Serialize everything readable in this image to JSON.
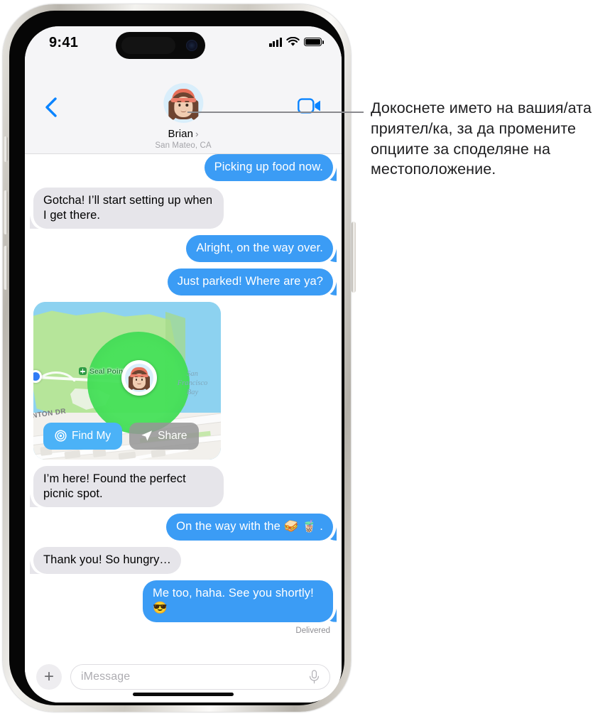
{
  "status_bar": {
    "time": "9:41",
    "cellular_icon": "cellular-signal-icon",
    "wifi_icon": "wifi-icon",
    "battery_icon": "battery-icon"
  },
  "nav": {
    "back_icon": "back-chevron-icon",
    "facetime_icon": "facetime-video-icon",
    "contact_name": "Brian",
    "name_chevron": "›",
    "location": "San Mateo, CA",
    "avatar_name": "memoji-avatar"
  },
  "messages": [
    {
      "id": "m1",
      "side": "out",
      "text": "Picking up food now."
    },
    {
      "id": "m2",
      "side": "in",
      "text": "Gotcha! I’ll start setting up when I get there."
    },
    {
      "id": "m3",
      "side": "out",
      "text": "Alright, on the way over."
    },
    {
      "id": "m4",
      "side": "out",
      "text": "Just parked! Where are ya?"
    },
    {
      "id": "m5",
      "side": "in",
      "text": "I’m here! Found the perfect picnic spot."
    },
    {
      "id": "m6",
      "side": "out",
      "text": "On the way with the 🥪 🧋 ."
    },
    {
      "id": "m7",
      "side": "in",
      "text": "Thank you! So hungry…"
    },
    {
      "id": "m8",
      "side": "out",
      "text": "Me too, haha. See you shortly! 😎"
    }
  ],
  "delivery_status": "Delivered",
  "map": {
    "park_label": "Seal Point Park",
    "bay_label": "San Francisco Bay",
    "street_label": "NTON DR",
    "find_my_button": "Find My",
    "share_button": "Share",
    "find_my_icon": "find-my-radar-icon",
    "share_icon": "share-arrow-icon",
    "pin_icon": "location-pin-avatar",
    "colors": {
      "water": "#8dd2f0",
      "park": "#b6e59a",
      "geofence": "#46e05a",
      "find_my_button": "#4bb2f7",
      "share_button": "rgba(150,150,150,.86)"
    }
  },
  "input_bar": {
    "plus_icon": "plus-icon",
    "placeholder": "iMessage",
    "mic_icon": "microphone-icon"
  },
  "annotation": {
    "text": "Докоснете името на вашия/ата приятел/ка, за да промените опциите за споделяне на местоположение."
  },
  "theme": {
    "outgoing_bubble": "#3b9cf5",
    "incoming_bubble": "#e6e5ea",
    "header_bg": "#f5f5f7",
    "accent_blue": "#0a84ff"
  }
}
